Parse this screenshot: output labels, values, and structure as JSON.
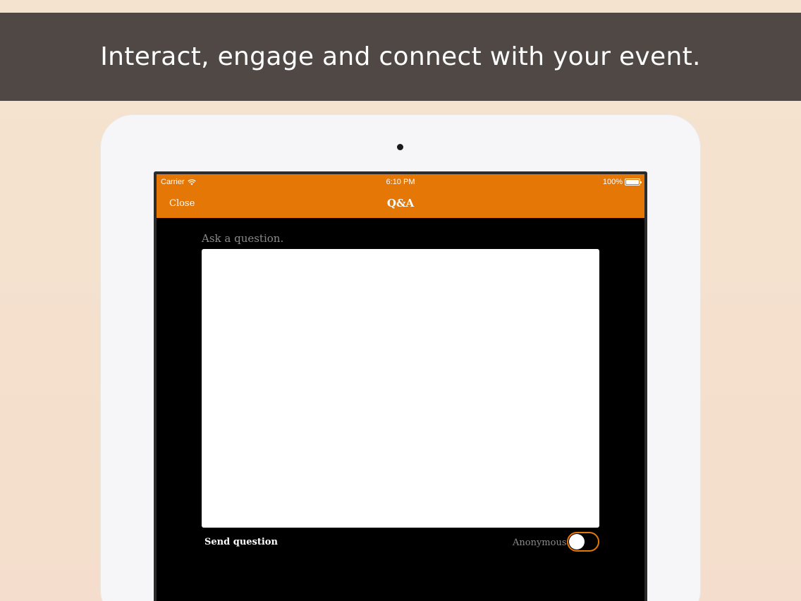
{
  "banner": {
    "text": "Interact, engage and connect with your event."
  },
  "status_bar": {
    "carrier": "Carrier",
    "time": "6:10 PM",
    "battery": "100%"
  },
  "navbar": {
    "close_label": "Close",
    "title": "Q&A"
  },
  "form": {
    "prompt": "Ask a question.",
    "question_value": "",
    "send_label": "Send question",
    "anonymous_label": "Anonymous",
    "anonymous_on": false
  },
  "colors": {
    "accent": "#e57707",
    "banner_bg": "#4f4845",
    "page_bg": "#f4e0cc",
    "screen_bg": "#000000"
  },
  "icons": {
    "wifi": "wifi-icon",
    "battery": "battery-icon"
  }
}
